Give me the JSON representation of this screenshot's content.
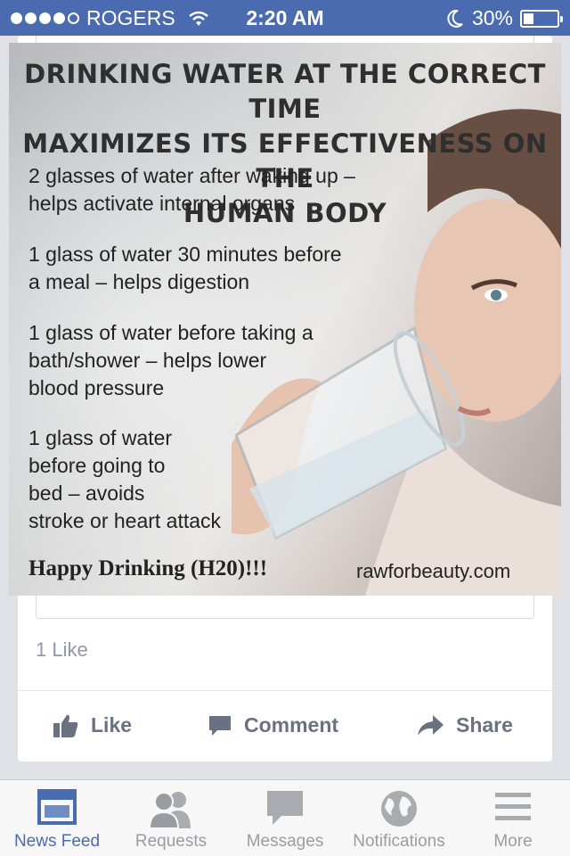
{
  "status_bar": {
    "carrier": "ROGERS",
    "time": "2:20 AM",
    "battery": "30%",
    "battery_level": 0.3,
    "signal_bars": 4
  },
  "post": {
    "image": {
      "headline": "DRINKING WATER AT THE CORRECT TIME\nMAXIMIZES ITS EFFECTIVENESS ON THE\nHUMAN BODY",
      "tips": [
        "2 glasses of water after waking up –\nhelps activate internal organs",
        "1 glass of water 30 minutes before\na meal – helps digestion",
        "1 glass of water before taking a\nbath/shower – helps lower\nblood pressure",
        "1 glass of water\nbefore going to\nbed – avoids\nstroke or heart attack"
      ],
      "signoff": "Happy Drinking (H20)!!!",
      "source": "rawforbeauty.com"
    },
    "likes": "1 Like",
    "actions": {
      "like": "Like",
      "comment": "Comment",
      "share": "Share"
    }
  },
  "tab_bar": {
    "tabs": [
      {
        "label": "News Feed",
        "icon": "news-feed-icon",
        "active": true
      },
      {
        "label": "Requests",
        "icon": "friend-requests-icon",
        "active": false
      },
      {
        "label": "Messages",
        "icon": "messages-icon",
        "active": false
      },
      {
        "label": "Notifications",
        "icon": "globe-icon",
        "active": false
      },
      {
        "label": "More",
        "icon": "menu-icon",
        "active": false
      }
    ]
  },
  "colors": {
    "brand": "#4a6bb0",
    "inactive": "#9a9ca2",
    "muted_text": "#9197a3"
  }
}
